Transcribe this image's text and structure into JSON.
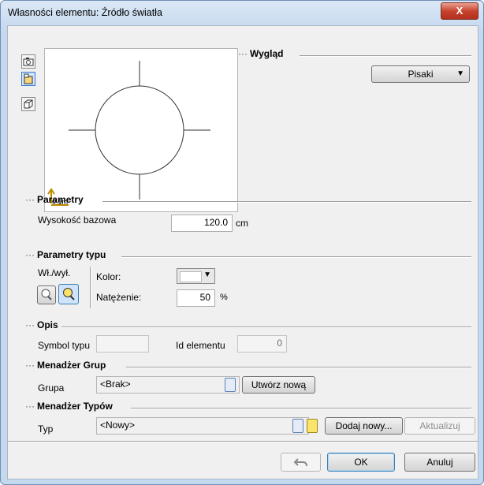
{
  "window": {
    "title": "Własności elementu: Źródło światła",
    "close_glyph": "X"
  },
  "side_icons": [
    "camera-icon",
    "plan-view-icon",
    "3d-view-icon"
  ],
  "preview": {
    "scale_label": "0.1m"
  },
  "wyglad": {
    "header": "Wygląd",
    "pisaki_label": "Pisaki",
    "arrow": "▼"
  },
  "parametry": {
    "header": "Parametry",
    "wysokosc_label": "Wysokość bazowa",
    "wysokosc_value": "120.0",
    "wysokosc_unit": "cm"
  },
  "parametry_typu": {
    "header": "Parametry typu",
    "wlwyl_label": "Wł./wył.",
    "kolor_label": "Kolor:",
    "natezenie_label": "Natężenie:",
    "natezenie_value": "50",
    "natezenie_unit": "%",
    "arrow": "▼",
    "kolor_value": "#ffffff"
  },
  "opis": {
    "header": "Opis",
    "symbol_label": "Symbol typu",
    "symbol_value": "",
    "id_label": "Id elementu",
    "id_value": "0"
  },
  "menadzer_grup": {
    "header": "Menadżer Grup",
    "grupa_label": "Grupa",
    "grupa_value": "<Brak>",
    "utworz_label": "Utwórz nową"
  },
  "menadzer_typow": {
    "header": "Menadżer Typów",
    "typ_label": "Typ",
    "typ_value": "<Nowy>",
    "dodaj_label": "Dodaj nowy...",
    "aktualizuj_label": "Aktualizuj"
  },
  "footer": {
    "ok_label": "OK",
    "anuluj_label": "Anuluj"
  },
  "section_prefix": "···"
}
